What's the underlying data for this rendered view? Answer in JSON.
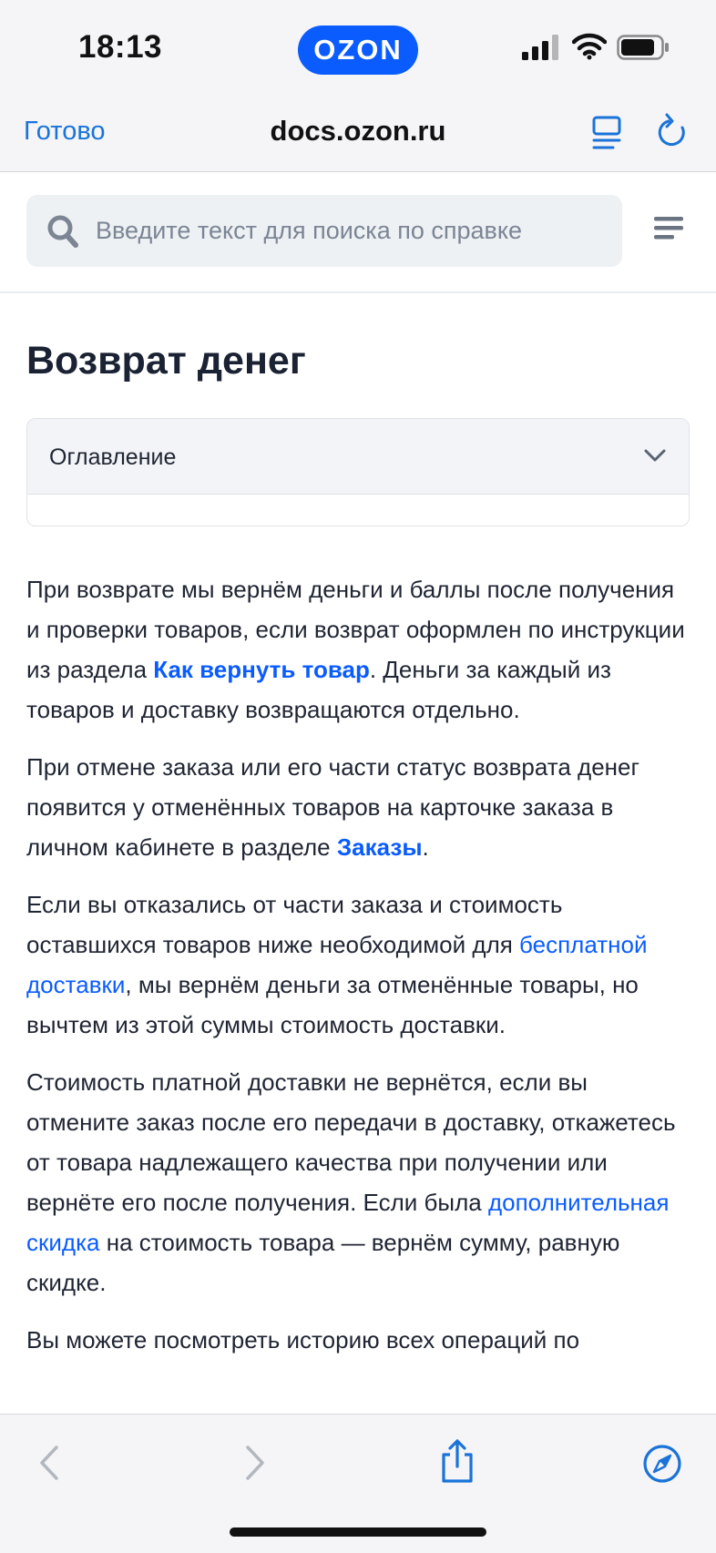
{
  "status_bar": {
    "time": "18:13",
    "brand": "OZON"
  },
  "nav_bar": {
    "done_label": "Готово",
    "domain": "docs.ozon.ru"
  },
  "search": {
    "placeholder": "Введите текст для поиска по справке"
  },
  "page": {
    "title": "Возврат денег",
    "toc_label": "Оглавление",
    "paragraphs": [
      {
        "t1": "При возврате мы вернём деньги и баллы после получения и проверки товаров, если возврат оформлен по инструкции из раздела ",
        "link": "Как вернуть товар",
        "t2": ". Деньги за каждый из товаров и доставку возвращаются отдельно."
      },
      {
        "t1": "При отмене заказа или его части статус возврата денег появится у отменённых товаров на карточке заказа в личном кабинете в разделе ",
        "link": "Заказы",
        "t2": "."
      },
      {
        "t1": "Если вы отказались от части заказа и стоимость оставшихся товаров ниже необходимой для ",
        "link": "бесплатной доставки",
        "t2": ", мы вернём деньги за отменённые товары, но вычтем из этой суммы стоимость доставки."
      },
      {
        "t1": "Стоимость платной доставки не вернётся, если вы отмените заказ после его передачи в доставку, откажетесь от товара надлежащего качества при получении или вернёте его после получения. Если была ",
        "link": "дополнительная скидка",
        "t2": " на стоимость товара — вернём сумму, равную скидке."
      },
      {
        "t1": "Вы можете посмотреть историю всех операций по"
      }
    ]
  },
  "colors": {
    "accent": "#0a5cff",
    "ios_link": "#1a73d9",
    "text": "#1f2533"
  }
}
